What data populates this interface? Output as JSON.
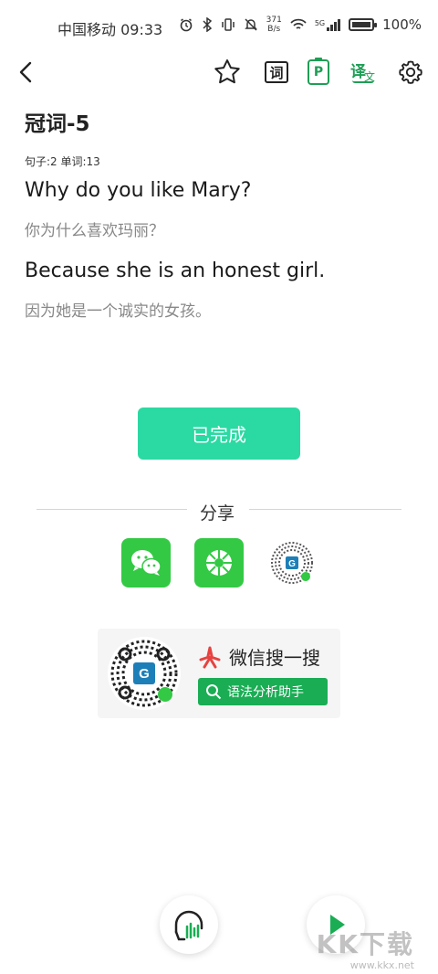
{
  "status": {
    "carrier_time": "中国移动 09:33",
    "net_speed_value": "371",
    "net_speed_unit": "B/s",
    "network": "5G",
    "battery": "100%",
    "battery_level": 1.0
  },
  "toolbar": {
    "vocab_icon_char": "词",
    "p_icon_char": "P",
    "translate_icon_char": "译",
    "translate_icon_sub": "文"
  },
  "lesson": {
    "title": "冠词-5",
    "counts": "句子:2 单词:13"
  },
  "sentences": [
    {
      "en": "Why do you like Mary?",
      "cn": "你为什么喜欢玛丽？"
    },
    {
      "en": "Because she is an honest girl.",
      "cn": "因为她是一个诚实的女孩。"
    }
  ],
  "done_button": "已完成",
  "share": {
    "label": "分享"
  },
  "wxcard": {
    "search_title": "微信搜一搜",
    "search_button": "语法分析助手"
  },
  "watermark": {
    "text": "KK下载",
    "url": "www.kkx.net"
  },
  "colors": {
    "accent": "#2bd9a2",
    "wechat_green": "#33c945",
    "toolbar_green": "#1f9e55"
  }
}
